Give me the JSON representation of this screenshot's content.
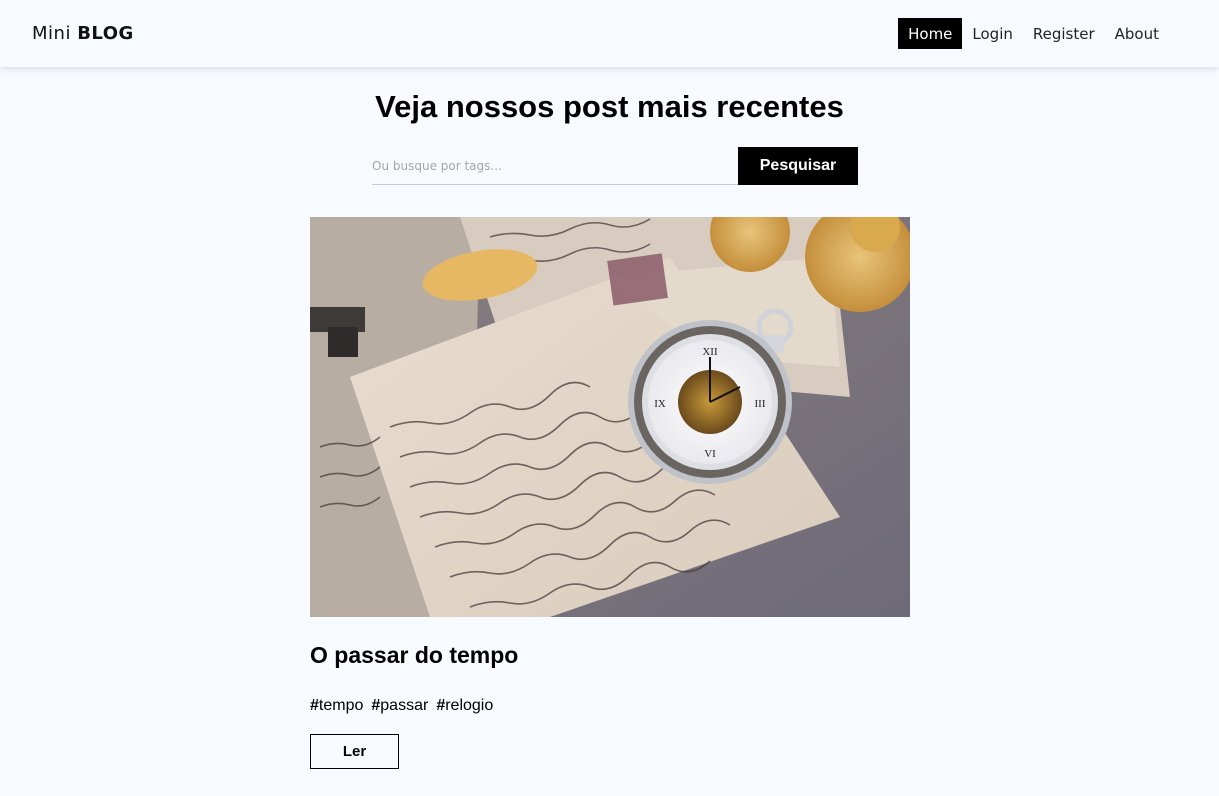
{
  "navbar": {
    "brand": {
      "light": "Mini",
      "strong": "BLOG"
    },
    "links": [
      {
        "label": "Home",
        "active": true
      },
      {
        "label": "Login",
        "active": false
      },
      {
        "label": "Register",
        "active": false
      },
      {
        "label": "About",
        "active": false
      }
    ]
  },
  "main": {
    "title": "Veja nossos post mais recentes",
    "search": {
      "placeholder": "Ou busque por tags...",
      "button_label": "Pesquisar"
    },
    "posts": [
      {
        "image_alt": "pocket watch on old handwritten letters",
        "title": "O passar do tempo",
        "tags": [
          "tempo",
          "passar",
          "relogio"
        ],
        "read_label": "Ler"
      }
    ]
  },
  "colors": {
    "background": "#f7fbff",
    "active_nav": "#000000",
    "button": "#000000"
  }
}
